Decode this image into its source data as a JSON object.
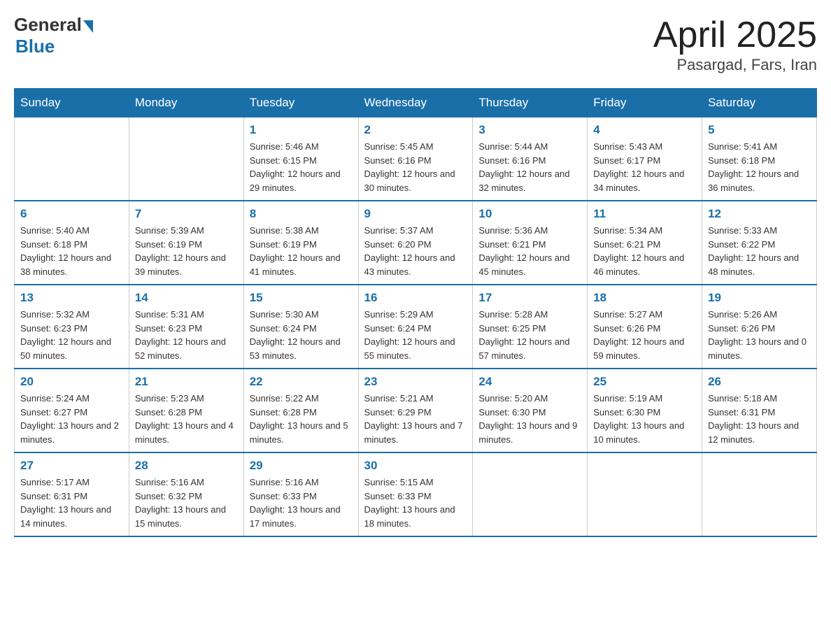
{
  "header": {
    "logo_general": "General",
    "logo_blue": "Blue",
    "month_title": "April 2025",
    "location": "Pasargad, Fars, Iran"
  },
  "days_of_week": [
    "Sunday",
    "Monday",
    "Tuesday",
    "Wednesday",
    "Thursday",
    "Friday",
    "Saturday"
  ],
  "weeks": [
    [
      null,
      null,
      {
        "day": "1",
        "sunrise": "Sunrise: 5:46 AM",
        "sunset": "Sunset: 6:15 PM",
        "daylight": "Daylight: 12 hours and 29 minutes."
      },
      {
        "day": "2",
        "sunrise": "Sunrise: 5:45 AM",
        "sunset": "Sunset: 6:16 PM",
        "daylight": "Daylight: 12 hours and 30 minutes."
      },
      {
        "day": "3",
        "sunrise": "Sunrise: 5:44 AM",
        "sunset": "Sunset: 6:16 PM",
        "daylight": "Daylight: 12 hours and 32 minutes."
      },
      {
        "day": "4",
        "sunrise": "Sunrise: 5:43 AM",
        "sunset": "Sunset: 6:17 PM",
        "daylight": "Daylight: 12 hours and 34 minutes."
      },
      {
        "day": "5",
        "sunrise": "Sunrise: 5:41 AM",
        "sunset": "Sunset: 6:18 PM",
        "daylight": "Daylight: 12 hours and 36 minutes."
      }
    ],
    [
      {
        "day": "6",
        "sunrise": "Sunrise: 5:40 AM",
        "sunset": "Sunset: 6:18 PM",
        "daylight": "Daylight: 12 hours and 38 minutes."
      },
      {
        "day": "7",
        "sunrise": "Sunrise: 5:39 AM",
        "sunset": "Sunset: 6:19 PM",
        "daylight": "Daylight: 12 hours and 39 minutes."
      },
      {
        "day": "8",
        "sunrise": "Sunrise: 5:38 AM",
        "sunset": "Sunset: 6:19 PM",
        "daylight": "Daylight: 12 hours and 41 minutes."
      },
      {
        "day": "9",
        "sunrise": "Sunrise: 5:37 AM",
        "sunset": "Sunset: 6:20 PM",
        "daylight": "Daylight: 12 hours and 43 minutes."
      },
      {
        "day": "10",
        "sunrise": "Sunrise: 5:36 AM",
        "sunset": "Sunset: 6:21 PM",
        "daylight": "Daylight: 12 hours and 45 minutes."
      },
      {
        "day": "11",
        "sunrise": "Sunrise: 5:34 AM",
        "sunset": "Sunset: 6:21 PM",
        "daylight": "Daylight: 12 hours and 46 minutes."
      },
      {
        "day": "12",
        "sunrise": "Sunrise: 5:33 AM",
        "sunset": "Sunset: 6:22 PM",
        "daylight": "Daylight: 12 hours and 48 minutes."
      }
    ],
    [
      {
        "day": "13",
        "sunrise": "Sunrise: 5:32 AM",
        "sunset": "Sunset: 6:23 PM",
        "daylight": "Daylight: 12 hours and 50 minutes."
      },
      {
        "day": "14",
        "sunrise": "Sunrise: 5:31 AM",
        "sunset": "Sunset: 6:23 PM",
        "daylight": "Daylight: 12 hours and 52 minutes."
      },
      {
        "day": "15",
        "sunrise": "Sunrise: 5:30 AM",
        "sunset": "Sunset: 6:24 PM",
        "daylight": "Daylight: 12 hours and 53 minutes."
      },
      {
        "day": "16",
        "sunrise": "Sunrise: 5:29 AM",
        "sunset": "Sunset: 6:24 PM",
        "daylight": "Daylight: 12 hours and 55 minutes."
      },
      {
        "day": "17",
        "sunrise": "Sunrise: 5:28 AM",
        "sunset": "Sunset: 6:25 PM",
        "daylight": "Daylight: 12 hours and 57 minutes."
      },
      {
        "day": "18",
        "sunrise": "Sunrise: 5:27 AM",
        "sunset": "Sunset: 6:26 PM",
        "daylight": "Daylight: 12 hours and 59 minutes."
      },
      {
        "day": "19",
        "sunrise": "Sunrise: 5:26 AM",
        "sunset": "Sunset: 6:26 PM",
        "daylight": "Daylight: 13 hours and 0 minutes."
      }
    ],
    [
      {
        "day": "20",
        "sunrise": "Sunrise: 5:24 AM",
        "sunset": "Sunset: 6:27 PM",
        "daylight": "Daylight: 13 hours and 2 minutes."
      },
      {
        "day": "21",
        "sunrise": "Sunrise: 5:23 AM",
        "sunset": "Sunset: 6:28 PM",
        "daylight": "Daylight: 13 hours and 4 minutes."
      },
      {
        "day": "22",
        "sunrise": "Sunrise: 5:22 AM",
        "sunset": "Sunset: 6:28 PM",
        "daylight": "Daylight: 13 hours and 5 minutes."
      },
      {
        "day": "23",
        "sunrise": "Sunrise: 5:21 AM",
        "sunset": "Sunset: 6:29 PM",
        "daylight": "Daylight: 13 hours and 7 minutes."
      },
      {
        "day": "24",
        "sunrise": "Sunrise: 5:20 AM",
        "sunset": "Sunset: 6:30 PM",
        "daylight": "Daylight: 13 hours and 9 minutes."
      },
      {
        "day": "25",
        "sunrise": "Sunrise: 5:19 AM",
        "sunset": "Sunset: 6:30 PM",
        "daylight": "Daylight: 13 hours and 10 minutes."
      },
      {
        "day": "26",
        "sunrise": "Sunrise: 5:18 AM",
        "sunset": "Sunset: 6:31 PM",
        "daylight": "Daylight: 13 hours and 12 minutes."
      }
    ],
    [
      {
        "day": "27",
        "sunrise": "Sunrise: 5:17 AM",
        "sunset": "Sunset: 6:31 PM",
        "daylight": "Daylight: 13 hours and 14 minutes."
      },
      {
        "day": "28",
        "sunrise": "Sunrise: 5:16 AM",
        "sunset": "Sunset: 6:32 PM",
        "daylight": "Daylight: 13 hours and 15 minutes."
      },
      {
        "day": "29",
        "sunrise": "Sunrise: 5:16 AM",
        "sunset": "Sunset: 6:33 PM",
        "daylight": "Daylight: 13 hours and 17 minutes."
      },
      {
        "day": "30",
        "sunrise": "Sunrise: 5:15 AM",
        "sunset": "Sunset: 6:33 PM",
        "daylight": "Daylight: 13 hours and 18 minutes."
      },
      null,
      null,
      null
    ]
  ]
}
